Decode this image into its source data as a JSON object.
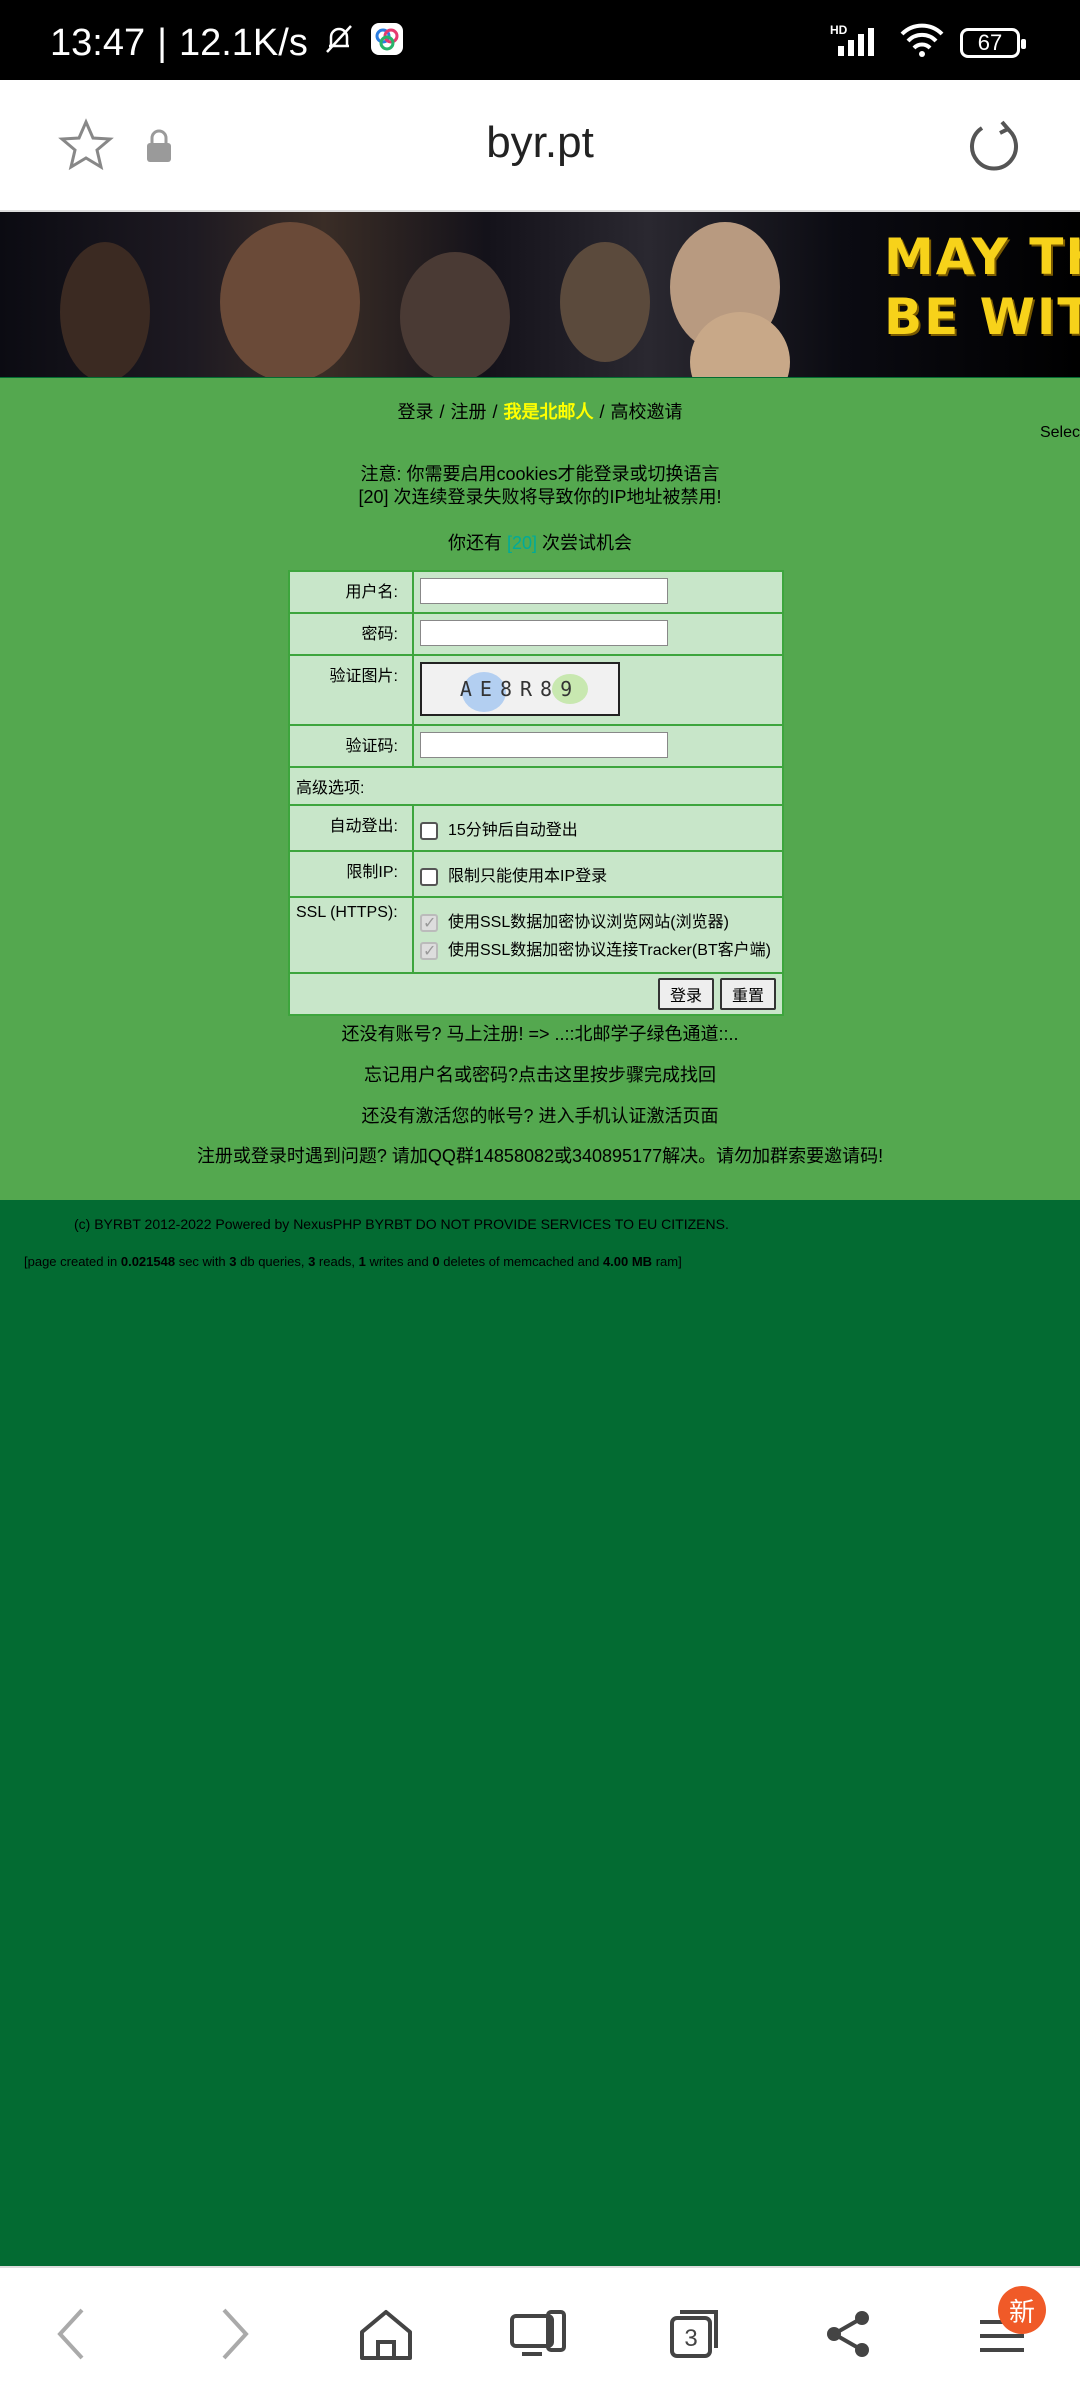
{
  "status_bar": {
    "time": "13:47",
    "speed": "12.1K/s",
    "network": "HD",
    "battery": "67"
  },
  "browser": {
    "url": "byr.pt"
  },
  "banner": {
    "line1": "MAY TH",
    "line2": "BE WIT"
  },
  "nav": {
    "login": "登录",
    "register": "注册",
    "bupt": "我是北邮人",
    "invite": "高校邀请",
    "select_cut": "Selec"
  },
  "notice": {
    "line1": "注意: 你需要启用cookies才能登录或切换语言",
    "line2": "[20] 次连续登录失败将导致你的IP地址被禁用!",
    "tries_prefix": "你还有 ",
    "tries_count": "[20]",
    "tries_suffix": " 次尝试机会"
  },
  "form": {
    "username_label": "用户名:",
    "password_label": "密码:",
    "captcha_image_label": "验证图片:",
    "captcha_text": "AE8R89",
    "captcha_label": "验证码:",
    "advanced_label": "高级选项:",
    "autologout_label": "自动登出:",
    "autologout_option": "15分钟后自动登出",
    "limitip_label": "限制IP:",
    "limitip_option": "限制只能使用本IP登录",
    "ssl_label": "SSL (HTTPS):",
    "ssl_browser_option": "使用SSL数据加密协议浏览网站(浏览器)",
    "ssl_tracker_option": "使用SSL数据加密协议连接Tracker(BT客户端)",
    "login_button": "登录",
    "reset_button": "重置"
  },
  "links": {
    "no_account": "还没有账号? 马上注册! => ..::北邮学子绿色通道::..",
    "forgot": "忘记用户名或密码?点击这里按步骤完成找回",
    "not_activated": "还没有激活您的帐号? 进入手机认证激活页面",
    "problem": "注册或登录时遇到问题? 请加QQ群14858082或340895177解决。请勿加群索要邀请码!"
  },
  "footer": {
    "copyright": "(c) BYRBT 2012-2022 Powered by NexusPHP BYRBT DO NOT PROVIDE SERVICES TO EU CITIZENS.",
    "created_prefix": "[page created in ",
    "created_time": "0.021548",
    "created_mid1": " sec with ",
    "db_queries": "3",
    "created_mid2": " db queries, ",
    "reads": "3",
    "created_mid3": " reads, ",
    "writes": "1",
    "created_mid4": " writes and ",
    "deletes": "0",
    "created_mid5": " deletes of memcached and ",
    "memory": "4.00 MB",
    "created_suffix": " ram]"
  },
  "bottom_nav": {
    "tabs_count": "3",
    "badge": "新"
  }
}
